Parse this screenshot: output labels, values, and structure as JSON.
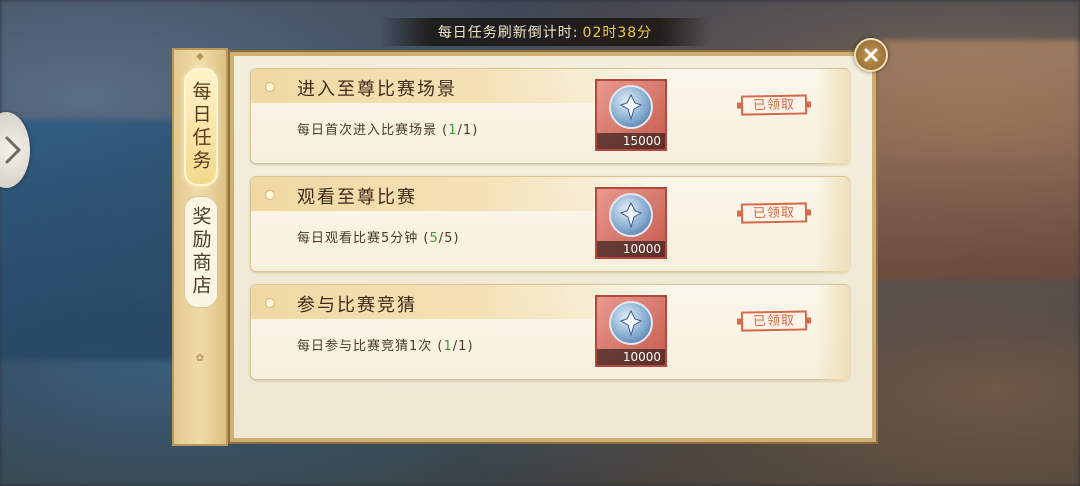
{
  "header": {
    "timer_label": "每日任务刷新倒计时:",
    "timer_value": "02时38分"
  },
  "tabs": [
    {
      "label": "每日任务",
      "active": true
    },
    {
      "label": "奖励商店",
      "active": false
    }
  ],
  "tasks": [
    {
      "title": "进入至尊比赛场景",
      "desc_text": "每日首次进入比赛场景",
      "progress_current": "1",
      "progress_total": "1",
      "reward_icon": "blue-token-icon",
      "reward_count": "15000",
      "status_label": "已领取"
    },
    {
      "title": "观看至尊比赛",
      "desc_text": "每日观看比赛5分钟",
      "progress_current": "5",
      "progress_total": "5",
      "reward_icon": "blue-token-icon",
      "reward_count": "10000",
      "status_label": "已领取"
    },
    {
      "title": "参与比赛竞猜",
      "desc_text": "每日参与比赛竞猜1次",
      "progress_current": "1",
      "progress_total": "1",
      "reward_icon": "blue-token-icon",
      "reward_count": "10000",
      "status_label": "已领取"
    }
  ],
  "colors": {
    "accent_gold": "#cfae73",
    "progress_green": "#3d9a3d",
    "claimed_red": "#d56a4a"
  }
}
